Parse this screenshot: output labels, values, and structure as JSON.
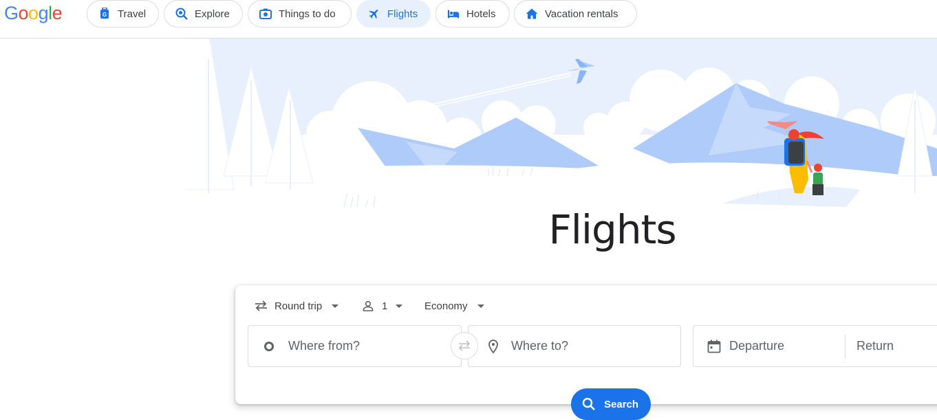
{
  "logo": {
    "text": "Google",
    "letters": [
      {
        "ch": "G",
        "color": "#4285f4"
      },
      {
        "ch": "o",
        "color": "#ea4335"
      },
      {
        "ch": "o",
        "color": "#fbbc05"
      },
      {
        "ch": "g",
        "color": "#4285f4"
      },
      {
        "ch": "l",
        "color": "#34a853"
      },
      {
        "ch": "e",
        "color": "#ea4335"
      }
    ]
  },
  "nav": {
    "travel": {
      "label": "Travel",
      "icon": "luggage-icon"
    },
    "explore": {
      "label": "Explore",
      "icon": "explore-search-icon"
    },
    "things": {
      "label": "Things to do",
      "icon": "camera-icon"
    },
    "flights": {
      "label": "Flights",
      "icon": "airplane-icon",
      "active": true
    },
    "hotels": {
      "label": "Hotels",
      "icon": "bed-icon"
    },
    "rentals": {
      "label": "Vacation rentals",
      "icon": "house-icon"
    }
  },
  "hero": {
    "title": "Flights"
  },
  "search_form": {
    "trip_type": "Round trip",
    "passengers": "1",
    "cabin_class": "Economy",
    "origin_placeholder": "Where from?",
    "destination_placeholder": "Where to?",
    "departure_placeholder": "Departure",
    "return_placeholder": "Return",
    "search_label": "Search"
  },
  "colors": {
    "accent": "#1a73e8",
    "active_chip_bg": "#e8f0fe"
  }
}
